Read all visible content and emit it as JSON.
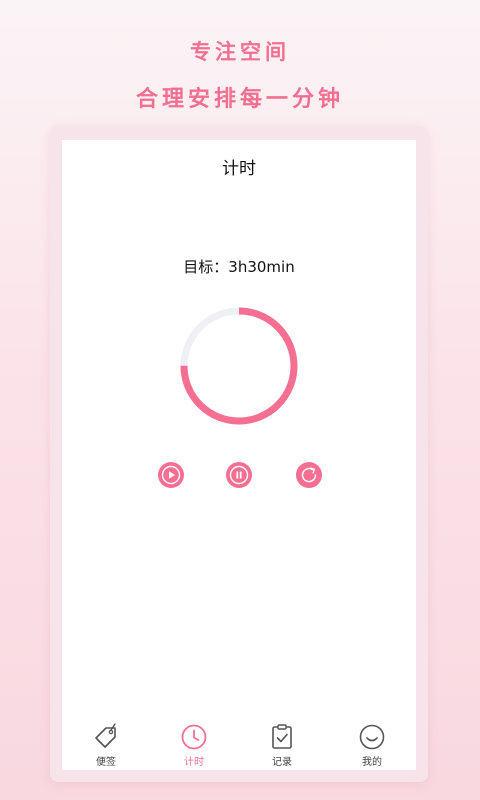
{
  "promo": {
    "line1": "专注空间",
    "line2": "合理安排每一分钟"
  },
  "screen": {
    "title": "计时",
    "goal_text": "目标：3h30min",
    "progress_fraction": 0.75
  },
  "controls": {
    "play_icon": "play-icon",
    "pause_icon": "pause-icon",
    "reset_icon": "refresh-icon"
  },
  "tabs": [
    {
      "label": "便签",
      "icon": "tag-icon",
      "active": false
    },
    {
      "label": "计时",
      "icon": "clock-icon",
      "active": true
    },
    {
      "label": "记录",
      "icon": "clipboard-check-icon",
      "active": false
    },
    {
      "label": "我的",
      "icon": "smile-icon",
      "active": false
    }
  ],
  "colors": {
    "accent": "#f56f93",
    "promo_text": "#f26f92",
    "ring_track": "#eef0f6",
    "tab_inactive": "#444444"
  }
}
